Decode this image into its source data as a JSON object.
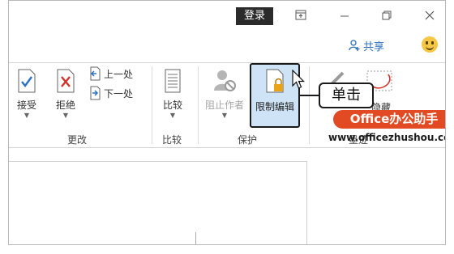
{
  "title_bar": {
    "signin_label": "登录",
    "ribbon_display_icon": "ribbon-display-options-icon",
    "minimize_icon": "minimize-icon",
    "restore_icon": "restore-icon",
    "close_icon": "close-icon"
  },
  "share": {
    "label": "共享",
    "icon": "share-person-icon"
  },
  "feedback_icon": "smiley-icon",
  "ribbon": {
    "changes_group": {
      "label": "更改",
      "accept": {
        "label": "接受"
      },
      "reject": {
        "label": "拒绝"
      },
      "previous": {
        "label": "上一处"
      },
      "next": {
        "label": "下一处"
      }
    },
    "compare_group": {
      "label": "比较",
      "compare": {
        "label": "比较"
      }
    },
    "protect_group": {
      "label": "保护",
      "block_authors": {
        "label": "阻止作者",
        "state": "disabled"
      },
      "restrict_editing": {
        "label": "限制编辑",
        "state": "highlighted"
      }
    },
    "ink_group": {
      "hide_label_fragment": "隐藏",
      "label_fragment": "墨迹"
    }
  },
  "annotation": {
    "callout_text": "单击"
  },
  "watermark": {
    "brand": "Office办公助手",
    "url": "www.officezhushou.com"
  },
  "colors": {
    "accent_blue": "#cfe3f6",
    "watermark_red": "#e14a22",
    "share_blue": "#2a6fb8"
  }
}
